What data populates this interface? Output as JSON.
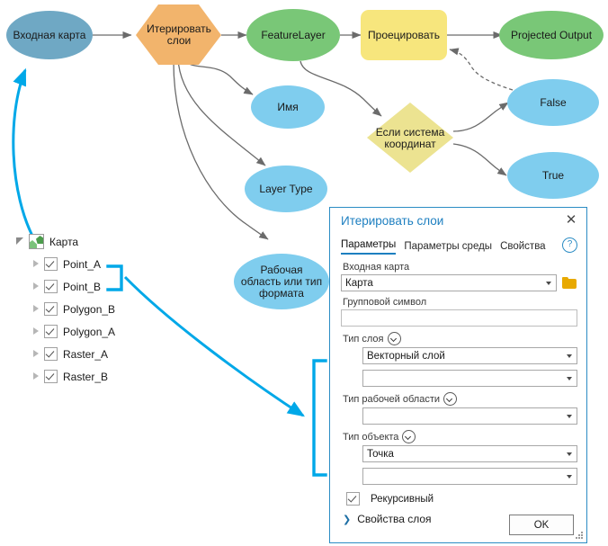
{
  "diagram": {
    "nodes": [
      {
        "id": "input-map",
        "label": "Входная карта",
        "shape": "ellipse",
        "color": "#6fa8c4"
      },
      {
        "id": "iterate-layers",
        "label": "Итерировать слои",
        "shape": "hexagon",
        "color": "#f2b46c"
      },
      {
        "id": "feature-layer",
        "label": "FeatureLayer",
        "shape": "ellipse",
        "color": "#79c777"
      },
      {
        "id": "project",
        "label": "Проецировать",
        "shape": "rounded-rect",
        "color": "#f7e67d"
      },
      {
        "id": "projected-output",
        "label": "Projected Output",
        "shape": "ellipse",
        "color": "#79c777"
      },
      {
        "id": "name",
        "label": "Имя",
        "shape": "ellipse",
        "color": "#7fcdee"
      },
      {
        "id": "layer-type",
        "label": "Layer Type",
        "shape": "ellipse",
        "color": "#7fcdee"
      },
      {
        "id": "workspace-or-format",
        "label": "Рабочая область или тип формата",
        "shape": "ellipse",
        "color": "#7fcdee"
      },
      {
        "id": "if-coord-system",
        "label": "Если система координат",
        "shape": "diamond",
        "color": "#ece391"
      },
      {
        "id": "false",
        "label": "False",
        "shape": "ellipse",
        "color": "#7fcdee"
      },
      {
        "id": "true",
        "label": "True",
        "shape": "ellipse",
        "color": "#7fcdee"
      }
    ],
    "annotation_color": "#00a8e8",
    "connector_color": "#6b6b6b"
  },
  "tree": {
    "root": {
      "label": "Карта",
      "icon": "map-icon"
    },
    "items": [
      {
        "label": "Point_A",
        "checked": true
      },
      {
        "label": "Point_B",
        "checked": true
      },
      {
        "label": "Polygon_B",
        "checked": true
      },
      {
        "label": "Polygon_A",
        "checked": true
      },
      {
        "label": "Raster_A",
        "checked": true
      },
      {
        "label": "Raster_B",
        "checked": true
      }
    ]
  },
  "dialog": {
    "title": "Итерировать слои",
    "close_icon": "close-icon",
    "help_icon": "help-icon",
    "tabs": [
      {
        "label": "Параметры",
        "active": true
      },
      {
        "label": "Параметры среды",
        "active": false
      },
      {
        "label": "Свойства",
        "active": false
      }
    ],
    "fields": {
      "input_map": {
        "label": "Входная карта",
        "value": "Карта",
        "browse_icon": "folder-icon"
      },
      "group_symbol": {
        "label": "Групповой символ",
        "value": ""
      },
      "layer_type": {
        "label": "Тип слоя",
        "value": "Векторный слой",
        "value2": ""
      },
      "workspace_type": {
        "label": "Тип рабочей области",
        "value": ""
      },
      "feature_type": {
        "label": "Тип объекта",
        "value": "Точка",
        "value2": ""
      }
    },
    "recursive": {
      "label": "Рекурсивный",
      "checked": true
    },
    "layer_properties": {
      "label": "Свойства слоя",
      "chevron": "chevron-right-icon"
    },
    "ok_button": "OK"
  }
}
